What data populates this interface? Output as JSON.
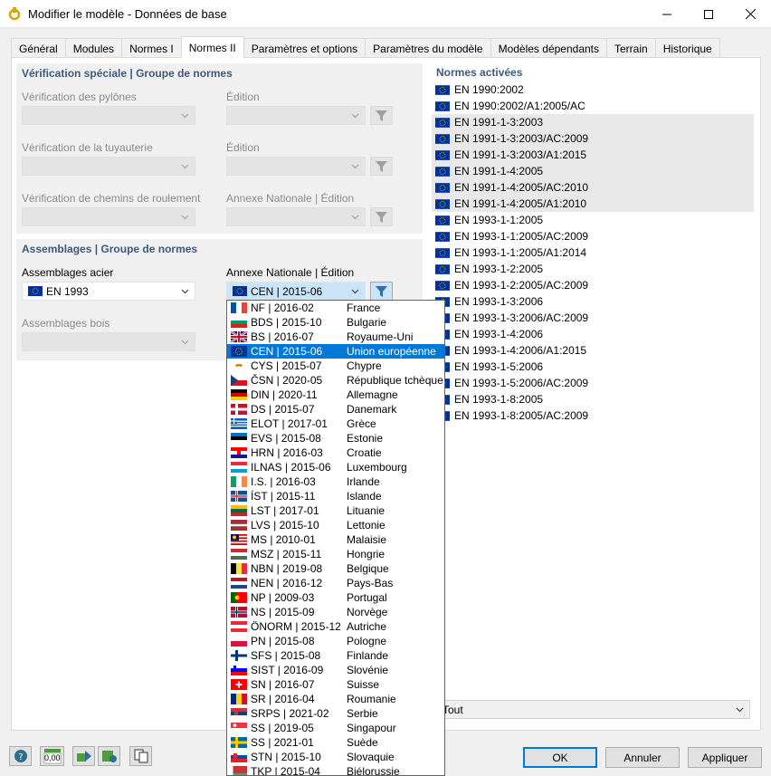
{
  "window": {
    "title": "Modifier le modèle - Données de base"
  },
  "tabs": [
    {
      "label": "Général"
    },
    {
      "label": "Modules"
    },
    {
      "label": "Normes I"
    },
    {
      "label": "Normes II",
      "active": true
    },
    {
      "label": "Paramètres et options"
    },
    {
      "label": "Paramètres du modèle"
    },
    {
      "label": "Modèles dépendants"
    },
    {
      "label": "Terrain"
    },
    {
      "label": "Historique"
    }
  ],
  "special": {
    "title": "Vérification spéciale | Groupe de normes",
    "pylons_label": "Vérification des pylônes",
    "edition1_label": "Édition",
    "piping_label": "Vérification de la tuyauterie",
    "edition2_label": "Édition",
    "runway_label": "Vérification de chemins de roulement",
    "annex_label": "Annexe Nationale | Édition"
  },
  "connections": {
    "title": "Assemblages | Groupe de normes",
    "steel_label": "Assemblages acier",
    "steel_value": "EN 1993",
    "annex_label": "Annexe Nationale | Édition",
    "annex_value": "CEN | 2015-06",
    "timber_label": "Assemblages bois"
  },
  "norms": {
    "title": "Normes activées",
    "items": [
      "EN 1990:2002",
      "EN 1990:2002/A1:2005/AC",
      "EN 1991-1-3:2003",
      "EN 1991-1-3:2003/AC:2009",
      "EN 1991-1-3:2003/A1:2015",
      "EN 1991-1-4:2005",
      "EN 1991-1-4:2005/AC:2010",
      "EN 1991-1-4:2005/A1:2010",
      "EN 1993-1-1:2005",
      "EN 1993-1-1:2005/AC:2009",
      "EN 1993-1-1:2005/A1:2014",
      "EN 1993-1-2:2005",
      "EN 1993-1-2:2005/AC:2009",
      "EN 1993-1-3:2006",
      "EN 1993-1-3:2006/AC:2009",
      "EN 1993-1-4:2006",
      "EN 1993-1-4:2006/A1:2015",
      "EN 1993-1-5:2006",
      "EN 1993-1-5:2006/AC:2009",
      "EN 1993-1-8:2005",
      "EN 1993-1-8:2005/AC:2009"
    ],
    "filter_value": "Tout"
  },
  "annex_options": [
    {
      "code": "NF | 2016-02",
      "country": "France",
      "flag": "fr"
    },
    {
      "code": "BDS | 2015-10",
      "country": "Bulgarie",
      "flag": "bg"
    },
    {
      "code": "BS | 2016-07",
      "country": "Royaume-Uni",
      "flag": "gb"
    },
    {
      "code": "CEN | 2015-06",
      "country": "Union européenne",
      "flag": "eu",
      "selected": true
    },
    {
      "code": "CYS | 2015-07",
      "country": "Chypre",
      "flag": "cy"
    },
    {
      "code": "ČSN | 2020-05",
      "country": "République tchèque",
      "flag": "cz"
    },
    {
      "code": "DIN | 2020-11",
      "country": "Allemagne",
      "flag": "de"
    },
    {
      "code": "DS | 2015-07",
      "country": "Danemark",
      "flag": "dk"
    },
    {
      "code": "ELOT | 2017-01",
      "country": "Grèce",
      "flag": "gr"
    },
    {
      "code": "EVS | 2015-08",
      "country": "Estonie",
      "flag": "ee"
    },
    {
      "code": "HRN | 2016-03",
      "country": "Croatie",
      "flag": "hr"
    },
    {
      "code": "ILNAS | 2015-06",
      "country": "Luxembourg",
      "flag": "lu"
    },
    {
      "code": "I.S. | 2016-03",
      "country": "Irlande",
      "flag": "ie"
    },
    {
      "code": "ÍST | 2015-11",
      "country": "Islande",
      "flag": "is"
    },
    {
      "code": "LST | 2017-01",
      "country": "Lituanie",
      "flag": "lt"
    },
    {
      "code": "LVS | 2015-10",
      "country": "Lettonie",
      "flag": "lv"
    },
    {
      "code": "MS | 2010-01",
      "country": "Malaisie",
      "flag": "my"
    },
    {
      "code": "MSZ | 2015-11",
      "country": "Hongrie",
      "flag": "hu"
    },
    {
      "code": "NBN | 2019-08",
      "country": "Belgique",
      "flag": "be"
    },
    {
      "code": "NEN | 2016-12",
      "country": "Pays-Bas",
      "flag": "nl"
    },
    {
      "code": "NP | 2009-03",
      "country": "Portugal",
      "flag": "pt"
    },
    {
      "code": "NS | 2015-09",
      "country": "Norvège",
      "flag": "no"
    },
    {
      "code": "ÖNORM | 2015-12",
      "country": "Autriche",
      "flag": "at"
    },
    {
      "code": "PN | 2015-08",
      "country": "Pologne",
      "flag": "pl"
    },
    {
      "code": "SFS | 2015-08",
      "country": "Finlande",
      "flag": "fi"
    },
    {
      "code": "SIST | 2016-09",
      "country": "Slovénie",
      "flag": "si"
    },
    {
      "code": "SN | 2016-07",
      "country": "Suisse",
      "flag": "ch"
    },
    {
      "code": "SR | 2016-04",
      "country": "Roumanie",
      "flag": "ro"
    },
    {
      "code": "SRPS | 2021-02",
      "country": "Serbie",
      "flag": "rs"
    },
    {
      "code": "SS | 2019-05",
      "country": "Singapour",
      "flag": "sg"
    },
    {
      "code": "SS | 2021-01",
      "country": "Suède",
      "flag": "se"
    },
    {
      "code": "STN | 2015-10",
      "country": "Slovaquie",
      "flag": "sk"
    },
    {
      "code": "TKP | 2015-04",
      "country": "Biélorussie",
      "flag": "by"
    }
  ],
  "footer": {
    "units_label": "0,00",
    "ok": "OK",
    "cancel": "Annuler",
    "apply": "Appliquer"
  },
  "colors": {
    "section_title": "#3c5a80",
    "selection": "#0078d7",
    "eu_blue": "#003399",
    "eu_gold": "#ffcc00"
  }
}
